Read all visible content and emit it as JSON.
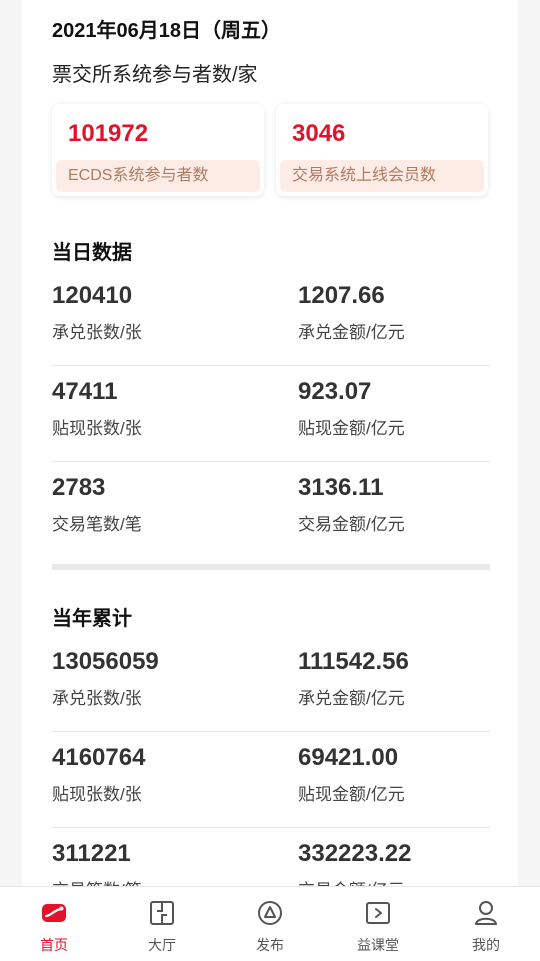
{
  "header": {
    "date": "2021年06月18日（周五）",
    "subtitle": "票交所系统参与者数/家"
  },
  "stats": [
    {
      "value": "101972",
      "label": "ECDS系统参与者数"
    },
    {
      "value": "3046",
      "label": "交易系统上线会员数"
    }
  ],
  "today": {
    "title": "当日数据",
    "rows": [
      {
        "left": {
          "value": "120410",
          "label": "承兑张数/张"
        },
        "right": {
          "value": "1207.66",
          "label": "承兑金额/亿元"
        }
      },
      {
        "left": {
          "value": "47411",
          "label": "贴现张数/张"
        },
        "right": {
          "value": "923.07",
          "label": "贴现金额/亿元"
        }
      },
      {
        "left": {
          "value": "2783",
          "label": "交易笔数/笔"
        },
        "right": {
          "value": "3136.11",
          "label": "交易金额/亿元"
        }
      }
    ]
  },
  "year": {
    "title": "当年累计",
    "rows": [
      {
        "left": {
          "value": "13056059",
          "label": "承兑张数/张"
        },
        "right": {
          "value": "111542.56",
          "label": "承兑金额/亿元"
        }
      },
      {
        "left": {
          "value": "4160764",
          "label": "贴现张数/张"
        },
        "right": {
          "value": "69421.00",
          "label": "贴现金额/亿元"
        }
      },
      {
        "left": {
          "value": "311221",
          "label": "交易笔数/笔"
        },
        "right": {
          "value": "332223.22",
          "label": "交易金额/亿元"
        }
      }
    ]
  },
  "tabs": [
    {
      "label": "首页",
      "icon": "home-icon",
      "active": true
    },
    {
      "label": "大厅",
      "icon": "hall-icon",
      "active": false
    },
    {
      "label": "发布",
      "icon": "publish-icon",
      "active": false
    },
    {
      "label": "益课堂",
      "icon": "classroom-icon",
      "active": false
    },
    {
      "label": "我的",
      "icon": "profile-icon",
      "active": false
    }
  ],
  "colors": {
    "accent": "#e0132b",
    "label_bg": "#fdece6",
    "label_text": "#b07a62"
  }
}
